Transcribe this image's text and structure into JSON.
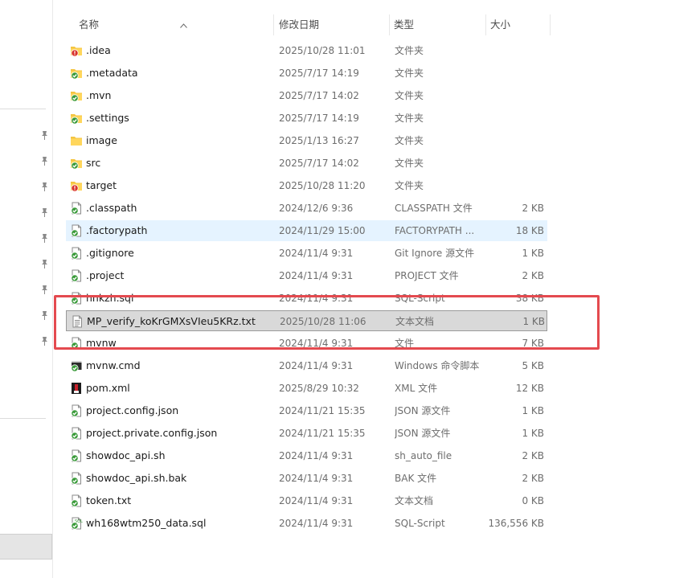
{
  "header": {
    "name": "名称",
    "date": "修改日期",
    "type": "类型",
    "size": "大小"
  },
  "colors": {
    "highlight_box": "#e44a4f",
    "hover_row": "#e5f3ff",
    "selected_row": "#d9d9d9",
    "folder": "#f4c542",
    "check_badge": "#3a9a3a",
    "error_badge": "#d9342b"
  },
  "files": [
    {
      "name": ".idea",
      "date": "2025/10/28 11:01",
      "type": "文件夹",
      "size": "",
      "icon": "folder-error-icon"
    },
    {
      "name": ".metadata",
      "date": "2025/7/17 14:19",
      "type": "文件夹",
      "size": "",
      "icon": "folder-check-icon"
    },
    {
      "name": ".mvn",
      "date": "2025/7/17 14:02",
      "type": "文件夹",
      "size": "",
      "icon": "folder-check-icon"
    },
    {
      "name": ".settings",
      "date": "2025/7/17 14:19",
      "type": "文件夹",
      "size": "",
      "icon": "folder-check-icon"
    },
    {
      "name": "image",
      "date": "2025/1/13 16:27",
      "type": "文件夹",
      "size": "",
      "icon": "folder-icon"
    },
    {
      "name": "src",
      "date": "2025/7/17 14:02",
      "type": "文件夹",
      "size": "",
      "icon": "folder-check-icon"
    },
    {
      "name": "target",
      "date": "2025/10/28 11:20",
      "type": "文件夹",
      "size": "",
      "icon": "folder-error-icon"
    },
    {
      "name": ".classpath",
      "date": "2024/12/6 9:36",
      "type": "CLASSPATH 文件",
      "size": "2 KB",
      "icon": "file-check-icon"
    },
    {
      "name": ".factorypath",
      "date": "2024/11/29 15:00",
      "type": "FACTORYPATH ...",
      "size": "18 KB",
      "icon": "file-check-icon",
      "state": "hover"
    },
    {
      "name": ".gitignore",
      "date": "2024/11/4 9:31",
      "type": "Git Ignore 源文件",
      "size": "1 KB",
      "icon": "file-check-icon"
    },
    {
      "name": ".project",
      "date": "2024/11/4 9:31",
      "type": "PROJECT 文件",
      "size": "2 KB",
      "icon": "file-check-icon"
    },
    {
      "name": "hnkzh.sql",
      "date": "2024/11/4 9:31",
      "type": "SQL-Script",
      "size": "38 KB",
      "icon": "file-check-icon"
    },
    {
      "name": "MP_verify_koKrGMXsVIeu5KRz.txt",
      "date": "2025/10/28 11:06",
      "type": "文本文档",
      "size": "1 KB",
      "icon": "text-file-icon",
      "state": "selected"
    },
    {
      "name": "mvnw",
      "date": "2024/11/4 9:31",
      "type": "文件",
      "size": "7 KB",
      "icon": "file-check-icon"
    },
    {
      "name": "mvnw.cmd",
      "date": "2024/11/4 9:31",
      "type": "Windows 命令脚本",
      "size": "5 KB",
      "icon": "cmd-file-check-icon"
    },
    {
      "name": "pom.xml",
      "date": "2025/8/29 10:32",
      "type": "XML 文件",
      "size": "12 KB",
      "icon": "xml-file-icon"
    },
    {
      "name": "project.config.json",
      "date": "2024/11/21 15:35",
      "type": "JSON 源文件",
      "size": "1 KB",
      "icon": "file-check-icon"
    },
    {
      "name": "project.private.config.json",
      "date": "2024/11/21 15:35",
      "type": "JSON 源文件",
      "size": "1 KB",
      "icon": "file-check-icon"
    },
    {
      "name": "showdoc_api.sh",
      "date": "2024/11/4 9:31",
      "type": "sh_auto_file",
      "size": "2 KB",
      "icon": "file-check-icon"
    },
    {
      "name": "showdoc_api.sh.bak",
      "date": "2024/11/4 9:31",
      "type": "BAK 文件",
      "size": "2 KB",
      "icon": "file-check-icon"
    },
    {
      "name": "token.txt",
      "date": "2024/11/4 9:31",
      "type": "文本文档",
      "size": "0 KB",
      "icon": "file-check-icon"
    },
    {
      "name": "wh168wtm250_data.sql",
      "date": "2024/11/4 9:31",
      "type": "SQL-Script",
      "size": "136,556 KB",
      "icon": "sql-file-check-icon"
    }
  ]
}
